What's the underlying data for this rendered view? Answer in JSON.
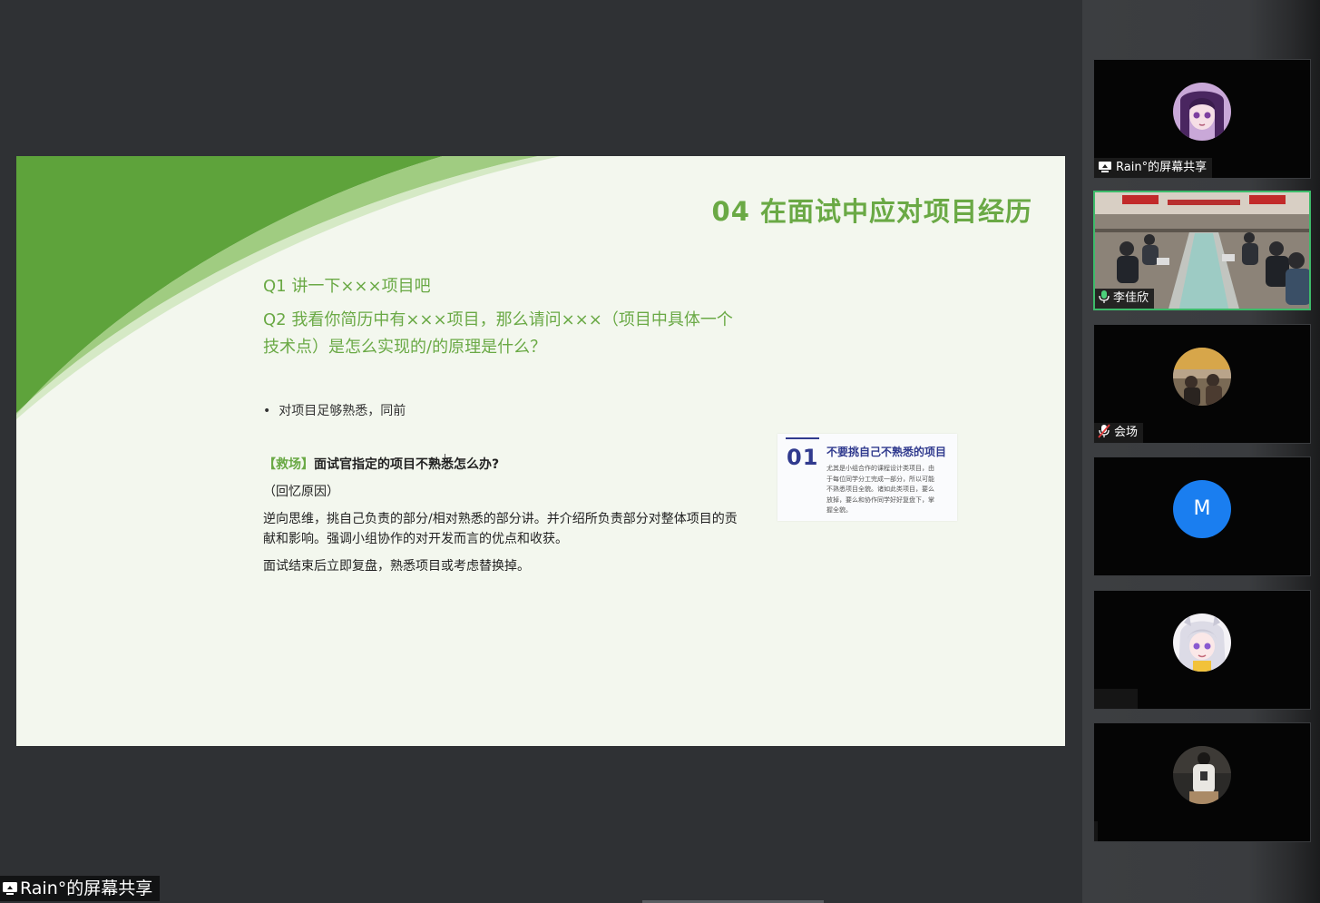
{
  "slide": {
    "title": "04 在面试中应对项目经历",
    "q1": "Q1  讲一下×××项目吧",
    "q2_line1": "Q2  我看你简历中有×××项目，那么请问×××（项目中具体一个",
    "q2_line2": "技术点）是怎么实现的/的原理是什么？",
    "bullet": "对项目足够熟悉，同前",
    "rescue_tag": "【救场】",
    "rescue_title": "面试官指定的项目不熟悉怎么办?",
    "recall": "（回忆原因）",
    "reverse_line1": "逆向思维，挑自己负责的部分/相对熟悉的部分讲。并介绍所负责部分对整体项目的贡",
    "reverse_line2": "献和影响。强调小组协作的对开发而言的优点和收获。",
    "review": "面试结束后立即复盘，熟悉项目或考虑替换掉。",
    "card": {
      "number": "01",
      "title": "不要挑自己不熟悉的项目",
      "body": "尤其是小组合作的课程设计类项目，由于每位同学分工完成一部分，所以可能不熟悉项目全貌。诸如此类项目，要么放掉，要么和协作同学好好复盘下，掌握全貌。"
    }
  },
  "share_label": "Rain°的屏幕共享",
  "participants": [
    {
      "name": "Rain°的屏幕共享",
      "icon": "screen-share-icon"
    },
    {
      "name": "李佳欣",
      "icon": "microphone-icon",
      "active": true
    },
    {
      "name": "会场",
      "icon": "microphone-muted-icon"
    },
    {
      "initial": "M"
    },
    {},
    {}
  ],
  "colors": {
    "slide_accent": "#6aa945",
    "card_accent": "#303a8e",
    "active_speaker_border": "#3dbb6a",
    "avatar_blue": "#1a7ef0"
  }
}
